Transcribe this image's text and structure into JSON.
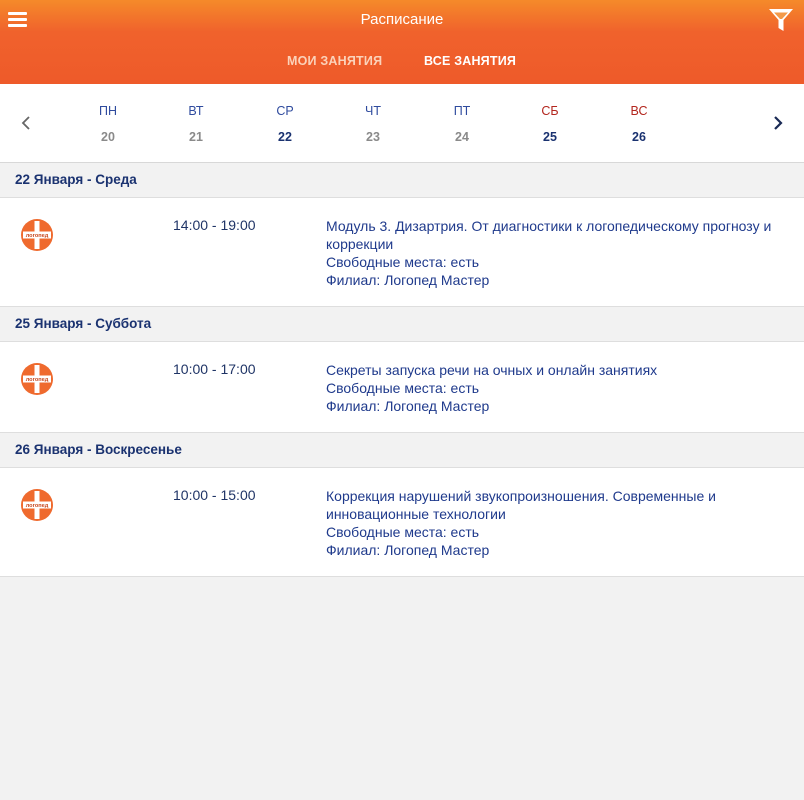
{
  "appbar": {
    "title": "Расписание",
    "menu_icon": "hamburger-menu-icon",
    "filter_icon": "funnel-filter-icon",
    "accent_color": "#f0622c"
  },
  "tabs": [
    {
      "label": "МОИ ЗАНЯТИЯ",
      "active": false
    },
    {
      "label": "ВСЕ ЗАНЯТИЯ",
      "active": true
    }
  ],
  "week": {
    "prev_icon": "chevron-left-icon",
    "next_icon": "chevron-right-icon",
    "days": [
      {
        "name": "ПН",
        "num": "20",
        "weekend": false,
        "selected": false
      },
      {
        "name": "ВТ",
        "num": "21",
        "weekend": false,
        "selected": false
      },
      {
        "name": "СР",
        "num": "22",
        "weekend": false,
        "selected": true
      },
      {
        "name": "ЧТ",
        "num": "23",
        "weekend": false,
        "selected": false
      },
      {
        "name": "ПТ",
        "num": "24",
        "weekend": false,
        "selected": false
      },
      {
        "name": "СБ",
        "num": "25",
        "weekend": true,
        "selected": false
      },
      {
        "name": "ВС",
        "num": "26",
        "weekend": true,
        "selected": false
      }
    ]
  },
  "schedule": [
    {
      "date": "22 Января - Среда",
      "sessions": [
        {
          "logo_text": "логопед",
          "time": "14:00 - 19:00",
          "title": "Модуль 3. Дизартрия. От диагностики к логопедическому прогнозу и коррекции",
          "seats": "Свободные места: есть",
          "branch": "Филиал: Логопед Мастер"
        }
      ]
    },
    {
      "date": "25 Января - Суббота",
      "sessions": [
        {
          "logo_text": "логопед",
          "time": "10:00 - 17:00",
          "title": "Секреты запуска речи на очных и онлайн занятиях",
          "seats": "Свободные места: есть",
          "branch": "Филиал: Логопед Мастер"
        }
      ]
    },
    {
      "date": "26 Января - Воскресенье",
      "sessions": [
        {
          "logo_text": "логопед",
          "time": "10:00 - 15:00",
          "title": "Коррекция нарушений звукопроизношения. Современные и инновационные технологии",
          "seats": "Свободные места: есть",
          "branch": "Филиал: Логопед Мастер"
        }
      ]
    }
  ]
}
